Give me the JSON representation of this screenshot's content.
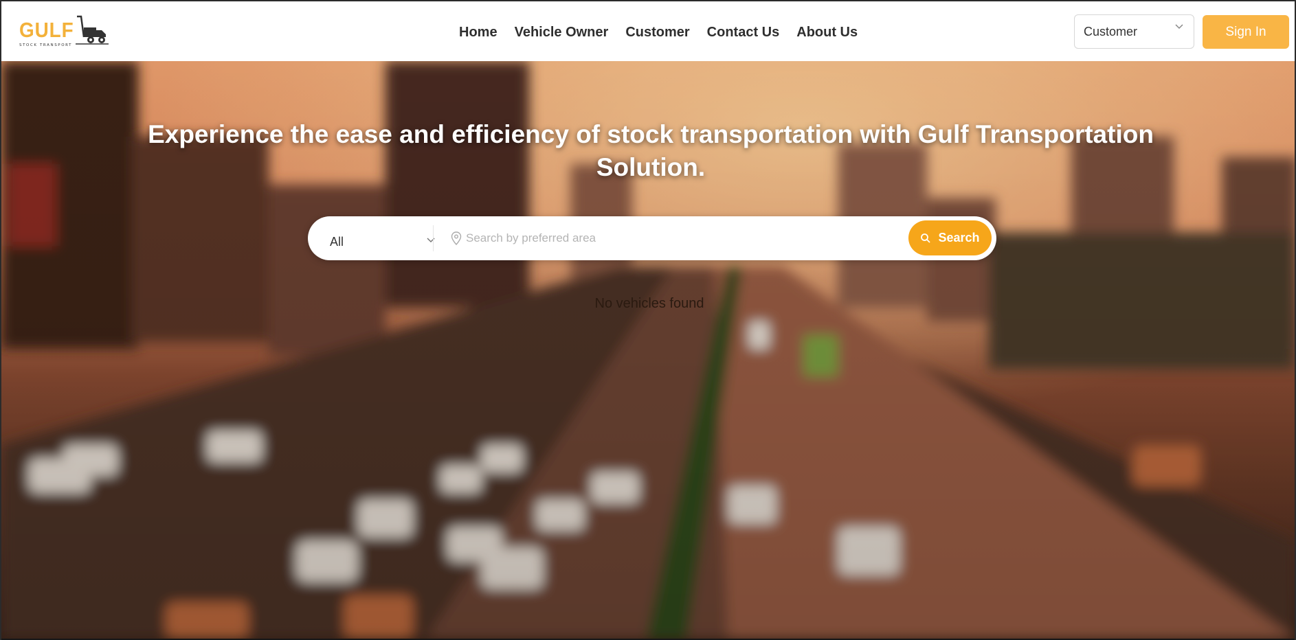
{
  "logo": {
    "word": "GULF",
    "sub": "STOCK TRANSPORT",
    "icon": "truck-icon"
  },
  "nav": {
    "items": [
      {
        "label": "Home"
      },
      {
        "label": "Vehicle Owner"
      },
      {
        "label": "Customer"
      },
      {
        "label": "Contact Us"
      },
      {
        "label": "About Us"
      }
    ]
  },
  "header": {
    "role_select_value": "Customer",
    "signin_label": "Sign In"
  },
  "hero": {
    "headline": "Experience the ease and efficiency of stock transportation with Gulf Transportation Solution.",
    "category_value": "All",
    "search_placeholder": "Search by preferred area",
    "search_button_label": "Search",
    "empty_message": "No vehicles found"
  },
  "colors": {
    "accent": "#f6a61a",
    "signin": "#f9b545",
    "logo": "#f3b13a",
    "nav_text": "#2e2e2e"
  }
}
